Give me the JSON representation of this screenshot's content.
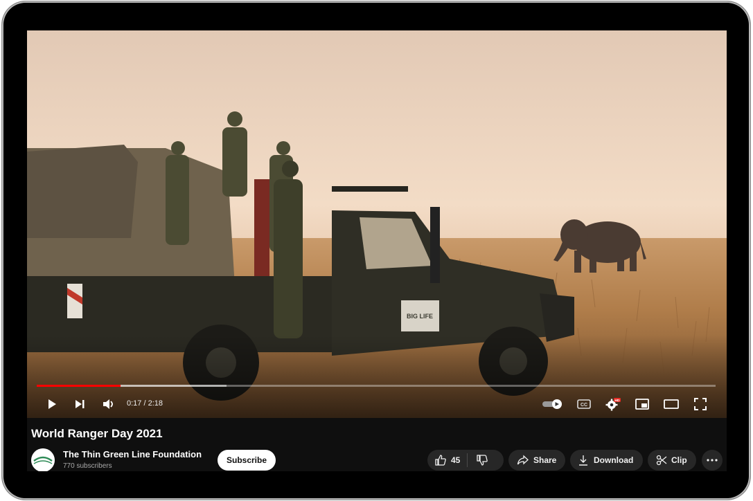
{
  "player": {
    "time_display": "0:17 / 2:18",
    "progress_fraction": 0.123,
    "buffered_fraction": 0.28,
    "hd_badge": "HD",
    "cc_label": "CC",
    "photo_sign_text": "BIG LIFE"
  },
  "video": {
    "title": "World Ranger Day 2021",
    "channel_name": "The Thin Green Line Foundation",
    "subscribers": "770 subscribers",
    "subscribe_label": "Subscribe",
    "like_count": "45",
    "share_label": "Share",
    "download_label": "Download",
    "clip_label": "Clip"
  },
  "colors": {
    "progress": "#ff0000",
    "pill_bg": "#272727",
    "page_bg": "#0f0f0f"
  }
}
